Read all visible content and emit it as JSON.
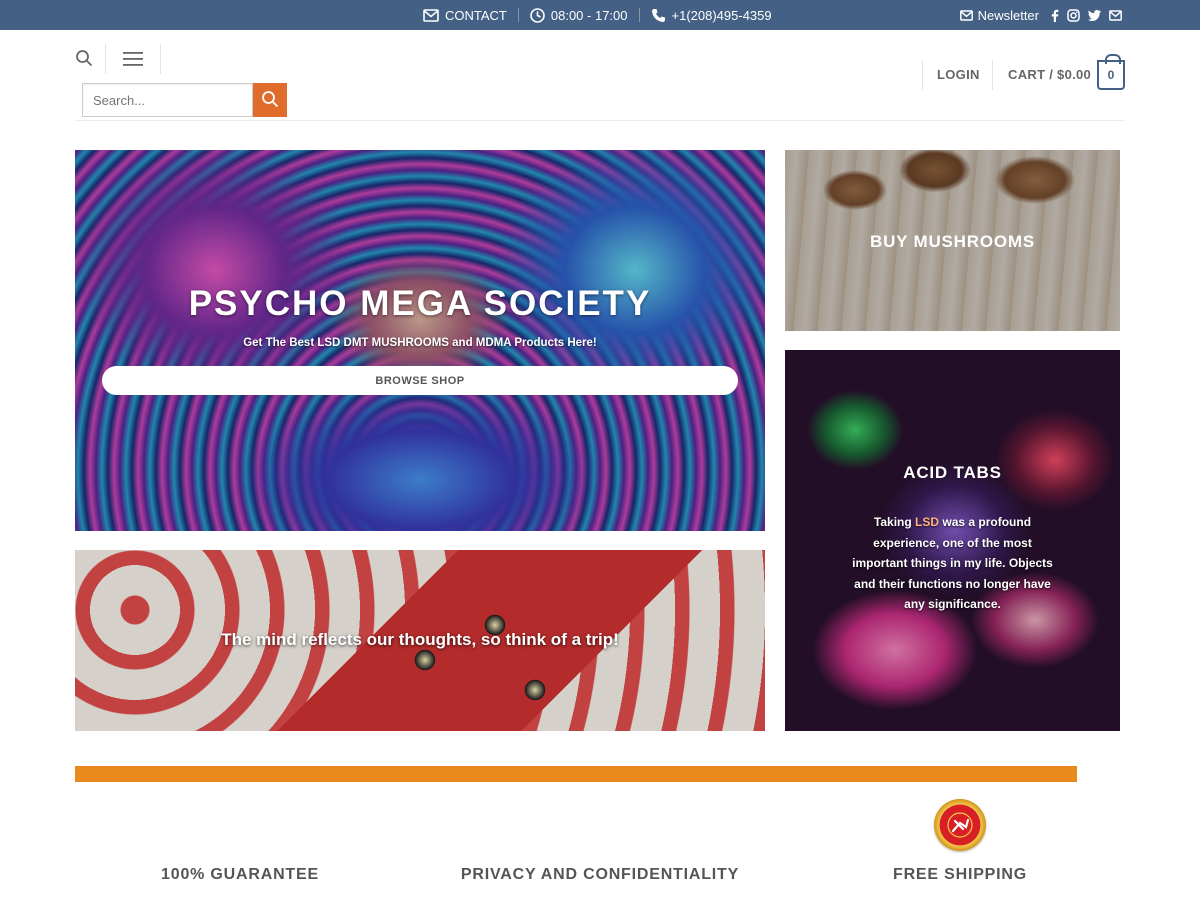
{
  "topbar": {
    "contact_label": "CONTACT",
    "hours": "08:00 - 17:00",
    "phone": "+1(208)495-4359",
    "newsletter_label": "Newsletter",
    "social_icons": [
      "facebook-icon",
      "instagram-icon",
      "twitter-icon",
      "email-icon"
    ],
    "bg_color": "#446084"
  },
  "header": {
    "search_placeholder": "Search...",
    "login_label": "LOGIN",
    "cart_label": "CART / $0.00",
    "cart_count": "0",
    "accent_color": "#e06c2c"
  },
  "banners": {
    "hero": {
      "title": "PSYCHO MEGA SOCIETY",
      "subtitle": "Get The Best LSD DMT MUSHROOMS and MDMA Products Here!",
      "button_label": "BROWSE SHOP"
    },
    "mushrooms": {
      "title": "BUY MUSHROOMS"
    },
    "acid": {
      "title": "ACID TABS",
      "text_before": "Taking ",
      "text_link": "LSD",
      "text_after": " was a profound experience, one of the most important things in my life. Objects and their functions no longer have any significance."
    },
    "trip": {
      "title": "The mind reflects our thoughts, so think of a trip!"
    }
  },
  "features": {
    "guarantee": "100% GUARANTEE",
    "privacy": "PRIVACY AND CONFIDENTIALITY",
    "shipping": "FREE SHIPPING"
  },
  "colors": {
    "orange_bar": "#ea8a1c",
    "cart_border": "#446084"
  }
}
